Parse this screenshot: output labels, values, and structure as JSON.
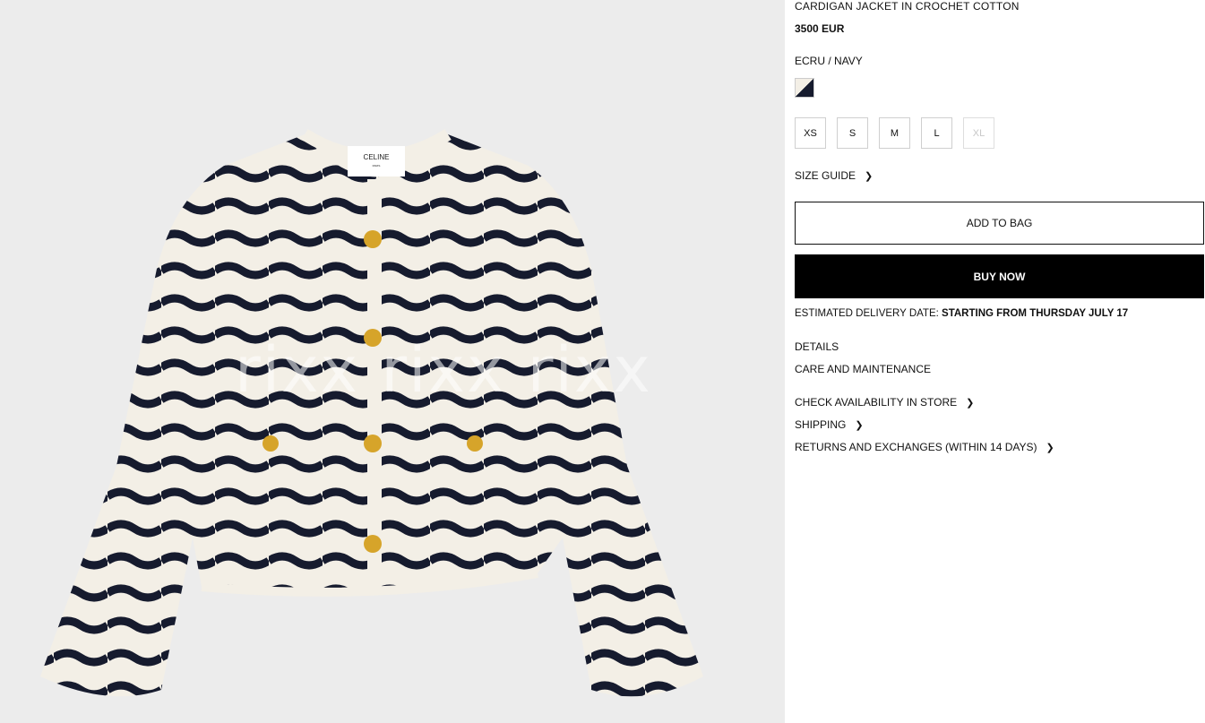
{
  "product": {
    "name": "CARDIGAN JACKET IN CROCHET COTTON",
    "price": "3500 EUR",
    "color_name": "ECRU / NAVY",
    "image_label": "CELINE",
    "image_sublabel": "PARIS",
    "watermark": "rixx  rixx  rixx"
  },
  "colors": {
    "ecru": "#f3efe6",
    "navy": "#161b2e",
    "background": "#ececec",
    "gold": "#d6a42a"
  },
  "sizes": [
    {
      "label": "XS",
      "available": true
    },
    {
      "label": "S",
      "available": true
    },
    {
      "label": "M",
      "available": true
    },
    {
      "label": "L",
      "available": true
    },
    {
      "label": "XL",
      "available": false
    }
  ],
  "size_guide": "SIZE GUIDE",
  "buttons": {
    "add_to_bag": "ADD TO BAG",
    "buy_now": "BUY NOW"
  },
  "delivery": {
    "label": "ESTIMATED DELIVERY DATE:",
    "value": "STARTING FROM THURSDAY JULY 17"
  },
  "sections": {
    "details": "DETAILS",
    "care": "CARE AND MAINTENANCE",
    "check_store": "CHECK AVAILABILITY IN STORE",
    "shipping": "SHIPPING",
    "returns": "RETURNS AND EXCHANGES (WITHIN 14 DAYS)"
  },
  "icons": {
    "chevron": "chevron-right-icon"
  }
}
